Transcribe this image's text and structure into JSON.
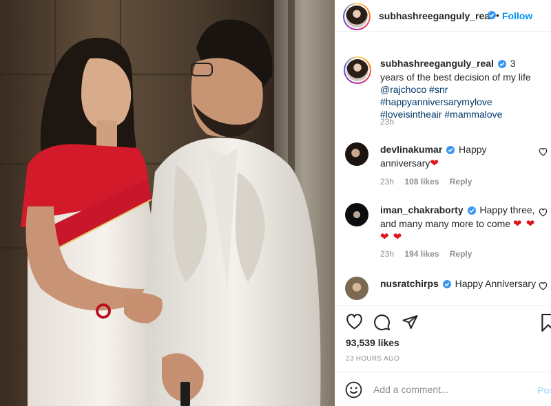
{
  "post": {
    "photo_alt": "",
    "author": {
      "username": "subhashreeganguly_real",
      "verified": true,
      "follow_label": "Follow",
      "separator": "•"
    },
    "caption": {
      "username": "subhashreeganguly_real",
      "text_before": "3 years of the best decision of my life",
      "mention": "@rajchoco",
      "hashtags": "#snr #happyanniversarymylove #loveisintheair #mammalove",
      "time": "23h"
    },
    "comments": [
      {
        "username": "devlinakumar",
        "verified": true,
        "text": "Happy anniversary",
        "emoji": "❤",
        "time": "23h",
        "likes": "108 likes",
        "reply": "Reply"
      },
      {
        "username": "iman_chakraborty",
        "verified": true,
        "text": "Happy three, and many many more to come",
        "emoji": "❤ ❤ ❤ ❤",
        "time": "23h",
        "likes": "194 likes",
        "reply": "Reply"
      },
      {
        "username": "nusratchirps",
        "verified": true,
        "text": "Happy Anniversary",
        "emoji": "",
        "time": "",
        "likes": "",
        "reply": ""
      }
    ],
    "likes_count": "93,539 likes",
    "posted_ago": "23 HOURS AGO",
    "add_comment": {
      "placeholder": "Add a comment...",
      "post_label": "Post"
    }
  },
  "icons": {
    "like": "heart-outline-icon",
    "comment": "comment-bubble-icon",
    "share": "paper-plane-icon",
    "save": "bookmark-icon",
    "emoji": "smiley-icon",
    "verified": "verified-badge-icon",
    "comment_like": "small-heart-icon"
  },
  "colors": {
    "accent": "#0095f6",
    "verified": "#3897f0",
    "heart": "#e0141e",
    "muted": "#8e8e8e",
    "post_disabled": "#b2dffc"
  }
}
